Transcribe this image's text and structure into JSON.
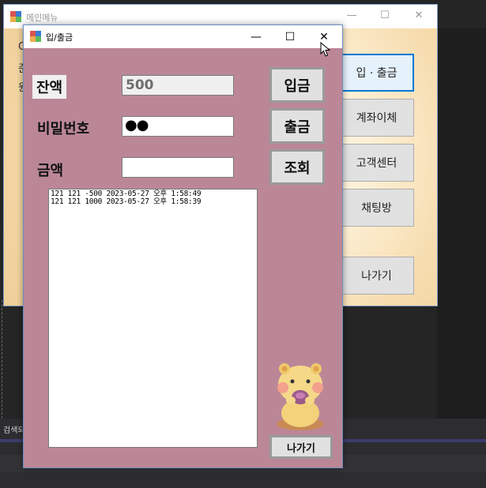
{
  "main_window": {
    "title": "메인메뉴",
    "left_texts": [
      "C",
      "준",
      "원"
    ],
    "menu_buttons": [
      {
        "label": "입 · 출금",
        "active": true
      },
      {
        "label": "계좌이체",
        "active": false
      },
      {
        "label": "고객센터",
        "active": false
      },
      {
        "label": "채팅방",
        "active": false
      },
      {
        "label": "나가기",
        "active": false
      }
    ],
    "controls": {
      "minimize": "—",
      "maximize": "☐",
      "close": "✕"
    }
  },
  "dw_window": {
    "title": "입/출금",
    "controls": {
      "minimize": "—",
      "maximize": "☐",
      "close": "✕"
    },
    "balance_label": "잔액",
    "balance_value": "500",
    "password_label": "비밀번호",
    "password_value": "●●",
    "amount_label": "금액",
    "amount_value": "",
    "deposit_button": "입금",
    "withdraw_button": "출금",
    "inquiry_button": "조회",
    "log_lines": [
      "121 121 -500 2023-05-27 오후 1:58:49",
      "121 121 1000 2023-05-27 오후 1:58:39"
    ],
    "exit_button": "나가기"
  },
  "ide": {
    "search_text": "검색되"
  },
  "colors": {
    "client_bg": "#bb8797",
    "accent": "#0078d7"
  }
}
